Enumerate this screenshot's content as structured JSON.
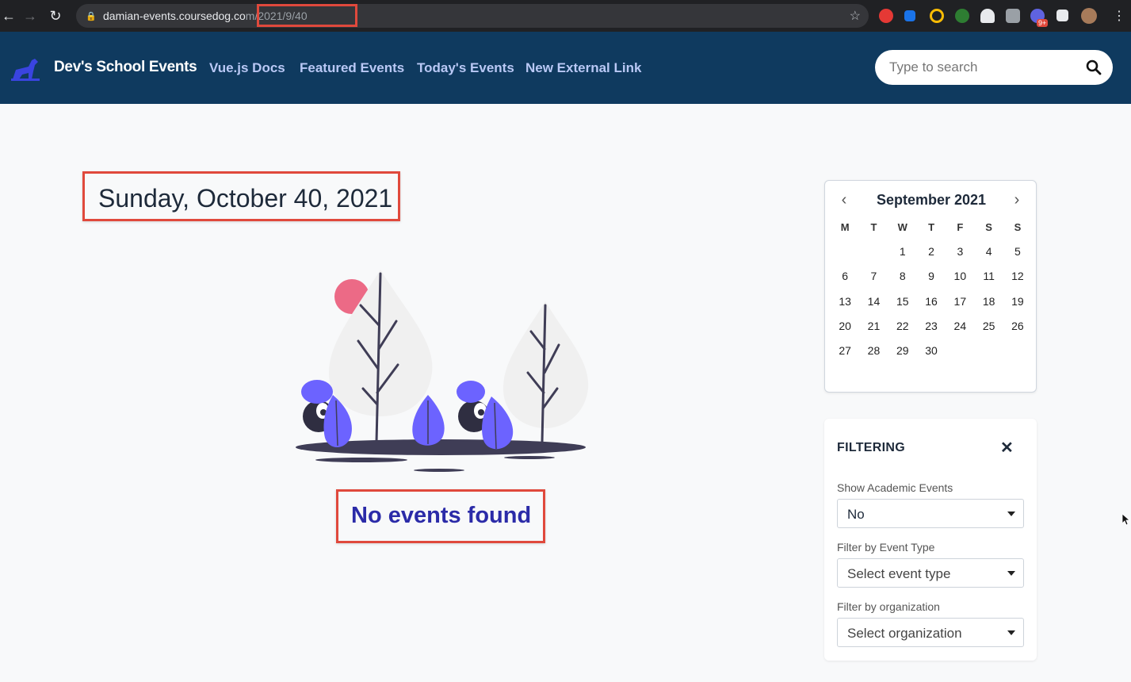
{
  "browser": {
    "url_host": "damian-events.coursedog.co",
    "url_path": "m/2021/9/40",
    "icons": [
      "back-icon",
      "forward-icon",
      "reload-icon",
      "lock-icon",
      "star-icon"
    ],
    "extension_badge": "9+"
  },
  "header": {
    "brand": "Dev's School Events",
    "nav": [
      "Vue.js Docs",
      "Featured Events",
      "Today's Events",
      "New External Link"
    ],
    "search_placeholder": "Type to search",
    "colors": {
      "background": "#0f3a5f",
      "link": "#b9c8f5"
    }
  },
  "main": {
    "date_title": "Sunday, October 40, 2021",
    "empty_message": "No events found",
    "accent_color": "#2b2ba8",
    "highlight_color": "#e0493c"
  },
  "calendar": {
    "month": "September 2021",
    "weekdays": [
      "M",
      "T",
      "W",
      "T",
      "F",
      "S",
      "S"
    ],
    "leading_blanks": 2,
    "days": [
      "1",
      "2",
      "3",
      "4",
      "5",
      "6",
      "7",
      "8",
      "9",
      "10",
      "11",
      "12",
      "13",
      "14",
      "15",
      "16",
      "17",
      "18",
      "19",
      "20",
      "21",
      "22",
      "23",
      "24",
      "25",
      "26",
      "27",
      "28",
      "29",
      "30"
    ]
  },
  "filters": {
    "title": "FILTERING",
    "close_symbol": "✕",
    "academic_label": "Show Academic Events",
    "academic_value": "No",
    "event_type_label": "Filter by Event Type",
    "event_type_placeholder": "Select event type",
    "organization_label": "Filter by organization",
    "organization_placeholder": "Select organization"
  }
}
